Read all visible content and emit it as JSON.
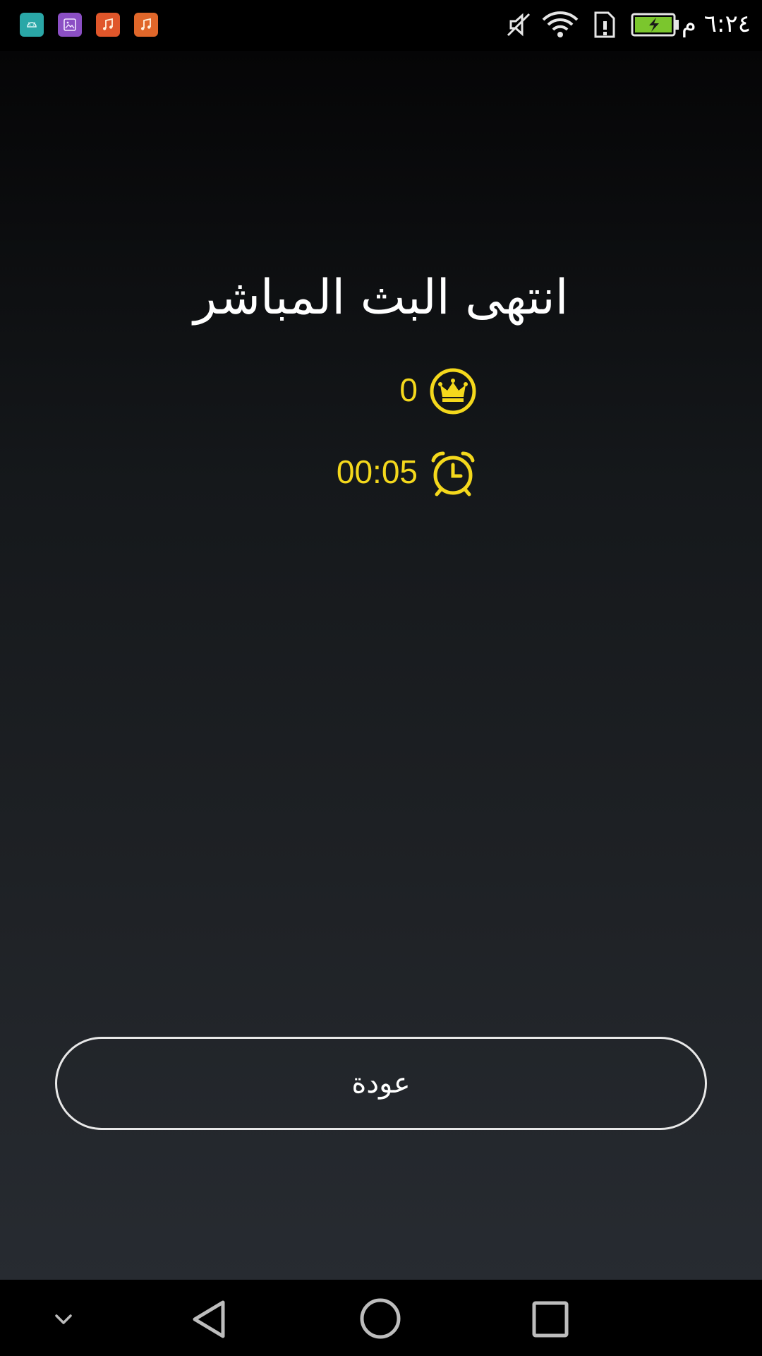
{
  "status_bar": {
    "notification_icons": [
      "android-icon",
      "gallery-icon",
      "music-note-icon",
      "music-note-icon"
    ],
    "system_icons": [
      "mute-icon",
      "wifi-icon",
      "sim-alert-icon",
      "battery-charging-icon"
    ],
    "time": "٦:٢٤ م",
    "battery_color": "#7bc62d"
  },
  "main": {
    "title": "انتهى البث المباشر",
    "viewers": {
      "icon": "crown-icon",
      "value": "0"
    },
    "duration": {
      "icon": "alarm-clock-icon",
      "value": "00:05"
    },
    "back_button_label": "عودة",
    "accent_color": "#f4d81c"
  },
  "nav_bar": {
    "buttons": [
      "chevron-down-icon",
      "back-triangle-icon",
      "home-circle-icon",
      "recents-square-icon"
    ]
  }
}
